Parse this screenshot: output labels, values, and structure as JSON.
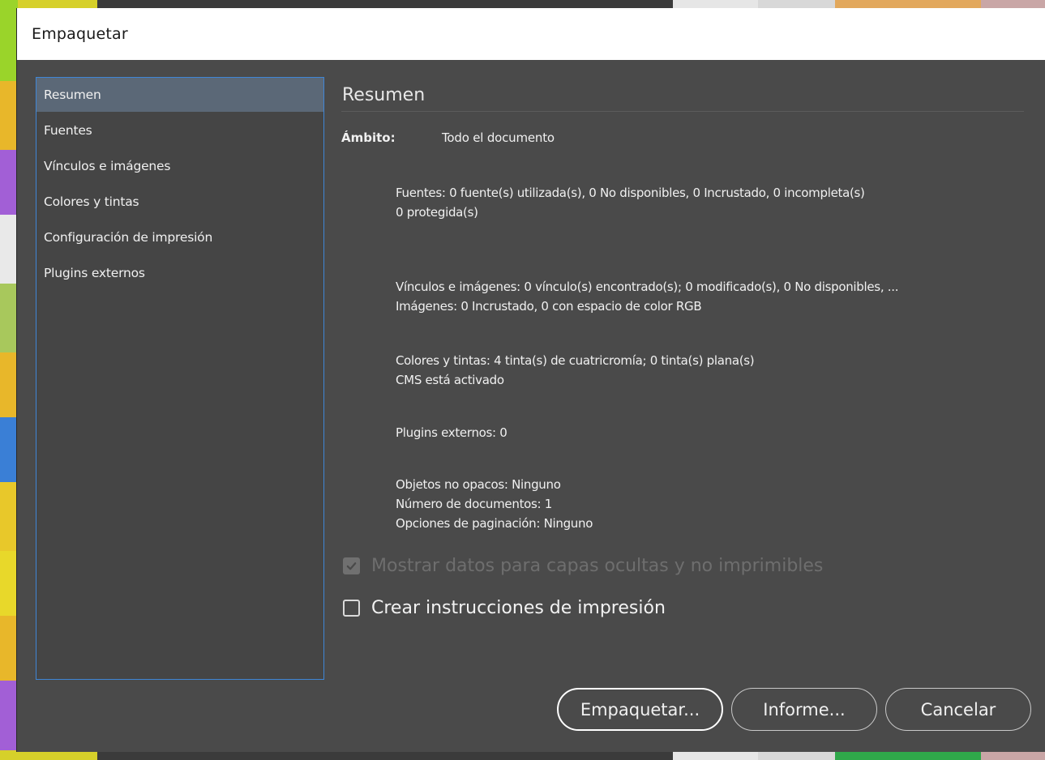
{
  "window": {
    "title": "Empaquetar"
  },
  "sidebar": {
    "items": [
      {
        "label": "Resumen",
        "selected": true
      },
      {
        "label": "Fuentes"
      },
      {
        "label": "Vínculos e imágenes"
      },
      {
        "label": "Colores y tintas"
      },
      {
        "label": "Configuración de impresión"
      },
      {
        "label": "Plugins externos"
      }
    ]
  },
  "summary": {
    "title": "Resumen",
    "scope_label": "Ámbito:",
    "scope_value": "Todo el documento",
    "fonts": [
      "Fuentes: 0 fuente(s) utilizada(s), 0 No disponibles, 0 Incrustado, 0 incompleta(s)",
      "0 protegida(s)"
    ],
    "links": [
      "Vínculos e imágenes: 0 vínculo(s) encontrado(s); 0 modificado(s), 0 No disponibles, ...",
      "Imágenes: 0 Incrustado, 0 con espacio de color RGB"
    ],
    "colors": [
      "Colores y tintas: 4 tinta(s) de cuatricromía; 0 tinta(s) plana(s)",
      "CMS está activado"
    ],
    "plugins": [
      "Plugins externos: 0"
    ],
    "objects": [
      "Objetos no opacos: Ninguno",
      "Número de documentos: 1",
      "Opciones de paginación: Ninguno"
    ]
  },
  "options": {
    "show_hidden_label": "Mostrar datos para capas ocultas y no imprimibles",
    "show_hidden_checked": true,
    "show_hidden_disabled": true,
    "print_instructions_label": "Crear instrucciones de impresión",
    "print_instructions_checked": false
  },
  "buttons": {
    "package": "Empaquetar...",
    "report": "Informe...",
    "cancel": "Cancelar"
  },
  "colors": {
    "dialog_bg": "#4a4a4a",
    "nav_selected": "#5b6877",
    "nav_border": "#3f86d6",
    "text": "#f0f0f0",
    "disabled_text": "#6e6e6e"
  }
}
